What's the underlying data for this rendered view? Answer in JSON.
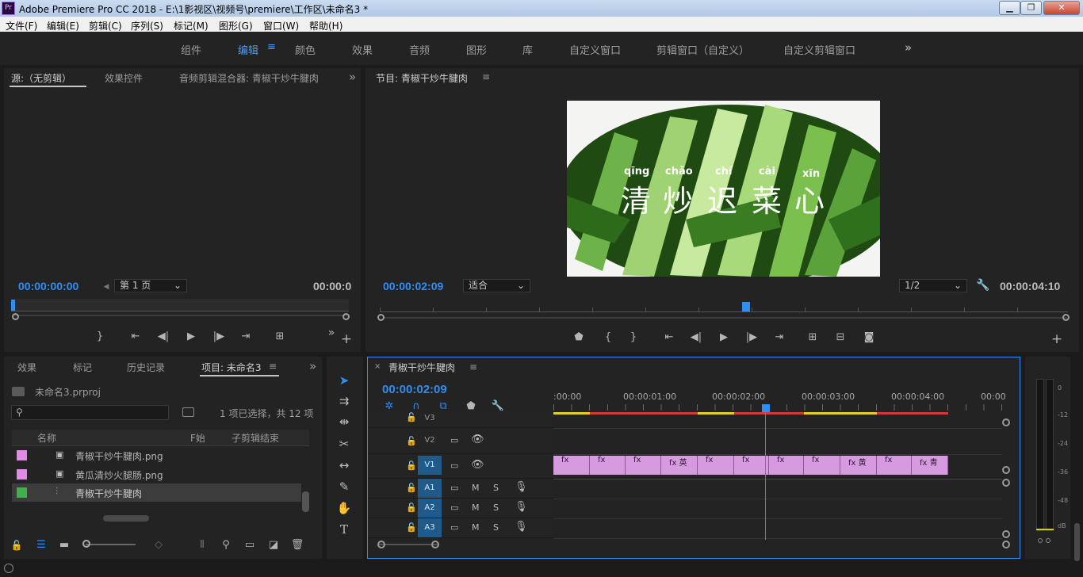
{
  "window": {
    "title": "Adobe Premiere Pro CC 2018 - E:\\1影视区\\视频号\\premiere\\工作区\\未命名3 *",
    "app_icon": "Pr"
  },
  "menu": [
    "文件(F)",
    "编辑(E)",
    "剪辑(C)",
    "序列(S)",
    "标记(M)",
    "图形(G)",
    "窗口(W)",
    "帮助(H)"
  ],
  "workspaces": [
    {
      "label": "组件",
      "active": false
    },
    {
      "label": "编辑",
      "active": true
    },
    {
      "label": "颜色",
      "active": false
    },
    {
      "label": "效果",
      "active": false
    },
    {
      "label": "音频",
      "active": false
    },
    {
      "label": "图形",
      "active": false
    },
    {
      "label": "库",
      "active": false
    },
    {
      "label": "自定义窗口",
      "active": false
    },
    {
      "label": "剪辑窗口（自定义）",
      "active": false
    },
    {
      "label": "自定义剪辑窗口",
      "active": false
    }
  ],
  "source_panel": {
    "tabs": [
      "源:（无剪辑）",
      "效果控件",
      "音频剪辑混合器: 青椒干炒牛腱肉"
    ],
    "timecode_in": "00:00:00:00",
    "page_select": "第 1 页",
    "timecode_out": "00:00:0"
  },
  "program_panel": {
    "title": "节目: 青椒干炒牛腱肉",
    "timecode": "00:00:02:09",
    "fit_select": "适合",
    "resolution_select": "1/2",
    "duration": "00:00:04:10",
    "overlay_pinyin": [
      "qīng",
      "chǎo",
      "chí",
      "cài",
      "xīn"
    ],
    "overlay_chars": [
      "清",
      "炒",
      "迟",
      "菜",
      "心"
    ]
  },
  "project_panel": {
    "tabs": [
      "效果",
      "标记",
      "历史记录",
      "项目: 未命名3"
    ],
    "project_file": "未命名3.prproj",
    "selection_status": "1 项已选择，共 12 项",
    "columns": [
      "名称",
      "F始",
      "子剪辑结束"
    ],
    "items": [
      {
        "name": "青椒干炒牛腱肉.png",
        "color": "#e08ae6",
        "type": "image"
      },
      {
        "name": "黄瓜清炒火腿肠.png",
        "color": "#e08ae6",
        "type": "image"
      },
      {
        "name": "青椒干炒牛腱肉",
        "color": "#3fb04c",
        "type": "sequence",
        "selected": true
      }
    ]
  },
  "timeline": {
    "sequence_name": "青椒干炒牛腱肉",
    "timecode": "00:00:02:09",
    "ruler_labels": [
      ":00:00",
      "00:00:01:00",
      "00:00:02:00",
      "00:00:03:00",
      "00:00:04:00",
      "00:00"
    ],
    "tracks": [
      {
        "name": "V3",
        "kind": "video",
        "active": false
      },
      {
        "name": "V2",
        "kind": "video",
        "active": false
      },
      {
        "name": "V1",
        "kind": "video",
        "active": true
      },
      {
        "name": "A1",
        "kind": "audio",
        "active": true
      },
      {
        "name": "A2",
        "kind": "audio",
        "active": true
      },
      {
        "name": "A3",
        "kind": "audio",
        "active": true
      }
    ],
    "clip_labels": [
      "fx",
      "fx",
      "fx",
      "fx 英",
      "fx",
      "fx",
      "fx",
      "fx",
      "fx 黄",
      "fx",
      "fx",
      "fx 青"
    ],
    "mute_label": "M",
    "solo_label": "S"
  },
  "audio_meter": {
    "labels": [
      "0",
      "-12",
      "-24",
      "-36",
      "-48",
      "dB"
    ]
  },
  "colors": {
    "accent": "#2e8ef5",
    "clip_pink": "#d79ae0",
    "track_blue": "#1f5a8a",
    "sequence_green": "#3fb04c"
  }
}
